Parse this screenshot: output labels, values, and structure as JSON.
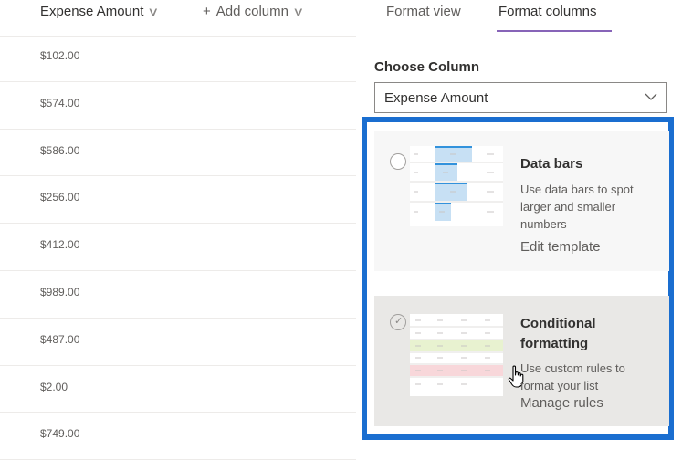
{
  "list": {
    "headers": {
      "amount": "Expense Amount",
      "add_column": "Add column",
      "add_icon": "+"
    },
    "rows": [
      "$102.00",
      "$574.00",
      "$586.00",
      "$256.00",
      "$412.00",
      "$989.00",
      "$487.00",
      "$2.00",
      "$749.00"
    ]
  },
  "pane": {
    "tabs": {
      "view": "Format view",
      "columns": "Format columns"
    },
    "choose_column_label": "Choose Column",
    "choose_column_value": "Expense Amount",
    "options": {
      "data_bars": {
        "title": "Data bars",
        "description": "Use data bars to spot larger and smaller numbers",
        "link": "Edit template"
      },
      "conditional": {
        "title": "Conditional formatting",
        "description": "Use custom rules to format your list",
        "link": "Manage rules",
        "check": "✓"
      }
    }
  },
  "colors": {
    "highlight_border": "#1a6ed0",
    "tab_underline": "#8764b8",
    "bar_fill": "#c7e0f4",
    "green_row": "#e8f2d0",
    "red_row": "#f8d7da"
  },
  "icons": [
    "chevron-down-icon",
    "plus-icon",
    "radio-icon",
    "check-icon",
    "hand-pointer-icon"
  ]
}
